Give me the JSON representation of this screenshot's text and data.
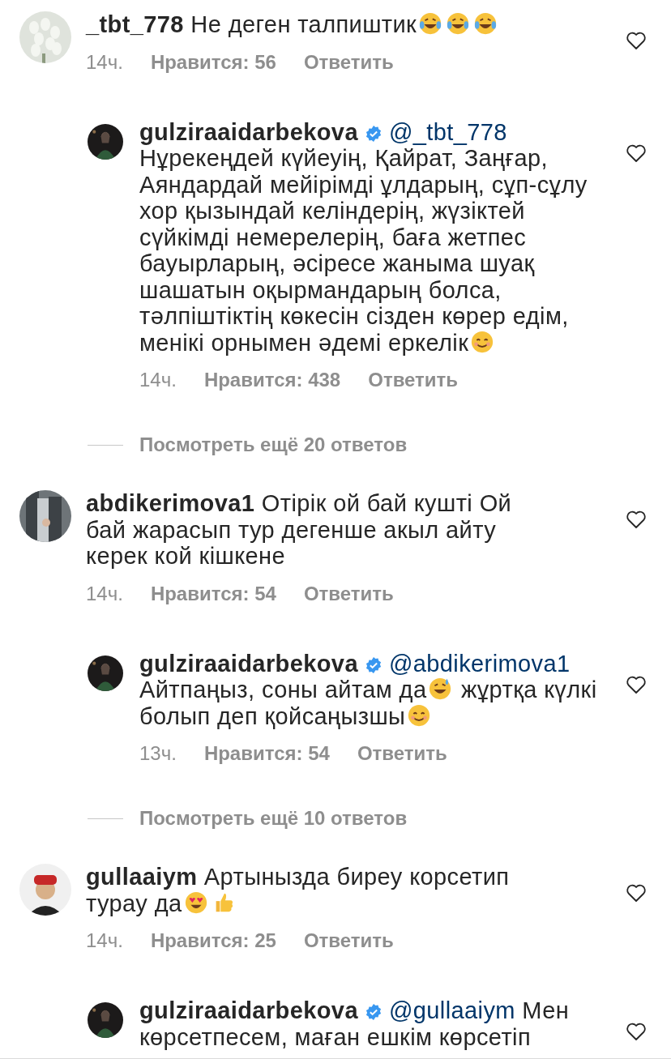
{
  "threads": [
    {
      "comment": {
        "username": "_tbt_778",
        "avatar": {
          "kind": "picture"
        },
        "segments": [
          {
            "kind": "text",
            "text": "Не деген талпиштик"
          },
          {
            "kind": "joy"
          },
          {
            "kind": "joy"
          },
          {
            "kind": "joy"
          }
        ],
        "time": "14ч.",
        "likes": "Нравится: 56",
        "reply": "Ответить",
        "liked": false
      },
      "replies": [
        {
          "username": "gulziraaidarbekova",
          "avatar": {
            "kind": "picture"
          },
          "verified": true,
          "mention": "@_tbt_778",
          "segments": [
            {
              "kind": "text",
              "text": "Нұрекеңдей күйеуің, Қайрат, Заңғар, Аяндардай мейірімді ұлдарың, сұп-сұлу хор қызындай келіндерің, жүзіктей сүйкімді немерелерің, баға жетпес бауырларың, әсіресе жаныма шуақ шашатын оқырмандарың болса, тәлпіштіктің көкесін сізден көрер едім, менікі орнымен әдемі еркелік"
            },
            {
              "kind": "smile"
            }
          ],
          "time": "14ч.",
          "likes": "Нравится: 438",
          "reply": "Ответить",
          "liked": false
        }
      ],
      "more": "Посмотреть ещё 20 ответов"
    },
    {
      "comment": {
        "username": "abdikerimova1",
        "avatar": {
          "kind": "picture"
        },
        "segments": [
          {
            "kind": "text",
            "text": "Отірік ой бай кушті Ой бай жарасып тур дегенше акыл айту керек кой кішкене"
          }
        ],
        "time": "14ч.",
        "likes": "Нравится: 54",
        "reply": "Ответить",
        "liked": false
      },
      "replies": [
        {
          "username": "gulziraaidarbekova",
          "avatar": {
            "kind": "picture"
          },
          "verified": true,
          "mention": "@abdikerimova1",
          "segments": [
            {
              "kind": "text",
              "text": "Айтпаңыз, соны айтам да"
            },
            {
              "kind": "sweat"
            },
            {
              "kind": "text",
              "text": " жұртқа күлкі болып деп қойсаңызшы"
            },
            {
              "kind": "smile"
            }
          ],
          "time": "13ч.",
          "likes": "Нравится: 54",
          "reply": "Ответить",
          "liked": false
        }
      ],
      "more": "Посмотреть ещё 10 ответов"
    },
    {
      "comment": {
        "username": "gullaaiym",
        "avatar": {
          "kind": "picture"
        },
        "segments": [
          {
            "kind": "text",
            "text": "Артынызда биреу корсетип турау да"
          },
          {
            "kind": "hearteyes"
          },
          {
            "kind": "thumbsup"
          }
        ],
        "time": "14ч.",
        "likes": "Нравится: 25",
        "reply": "Ответить",
        "liked": false
      },
      "replies": [
        {
          "username": "gulziraaidarbekova",
          "avatar": {
            "kind": "picture"
          },
          "verified": true,
          "mention": "@gullaaiym",
          "segments": [
            {
              "kind": "text",
              "text": "  Мен көрсетпесем, маған ешкім көрсетіп"
            }
          ],
          "liked": false
        }
      ]
    }
  ]
}
